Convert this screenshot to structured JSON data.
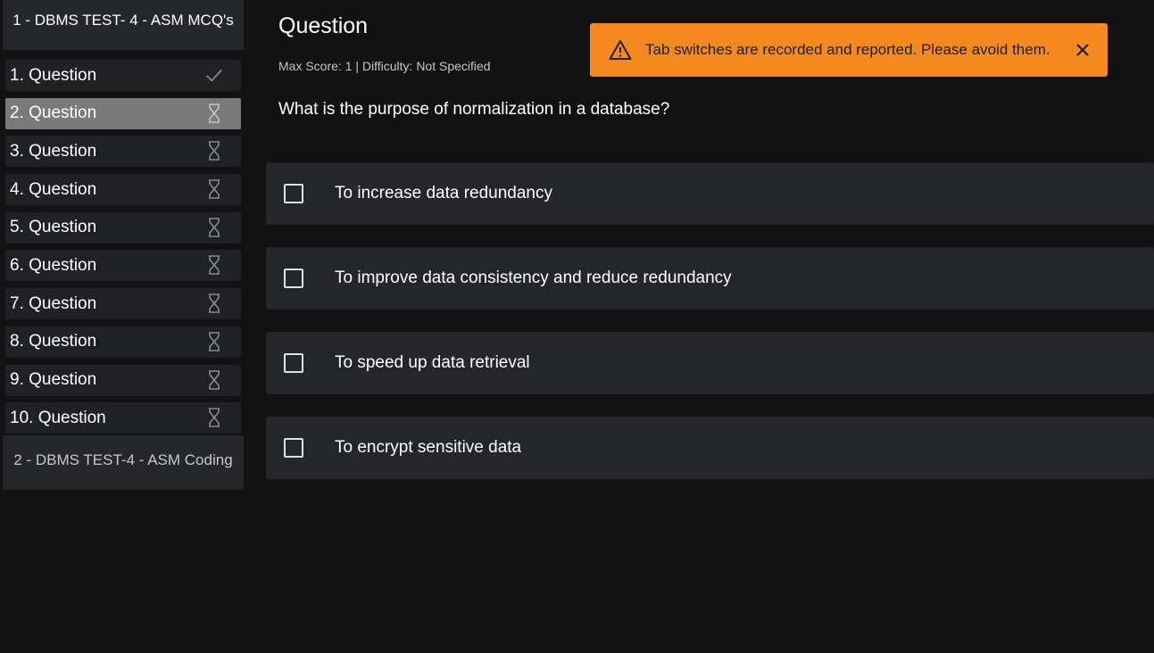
{
  "sidebar": {
    "section1_title": "1 - DBMS TEST- 4 - ASM MCQ's",
    "questions": [
      {
        "label": "1. Question",
        "status": "check-icon"
      },
      {
        "label": "2. Question",
        "status": "hourglass-icon",
        "active": true
      },
      {
        "label": "3. Question",
        "status": "hourglass-icon"
      },
      {
        "label": "4. Question",
        "status": "hourglass-icon"
      },
      {
        "label": "5. Question",
        "status": "hourglass-icon"
      },
      {
        "label": "6. Question",
        "status": "hourglass-icon"
      },
      {
        "label": "7. Question",
        "status": "hourglass-icon"
      },
      {
        "label": "8. Question",
        "status": "hourglass-icon"
      },
      {
        "label": "9. Question",
        "status": "hourglass-icon"
      },
      {
        "label": "10. Question",
        "status": "hourglass-icon"
      }
    ],
    "section2_title": "2 - DBMS TEST-4 - ASM Coding"
  },
  "main": {
    "title": "Question",
    "meta": "Max Score: 1 | Difficulty: Not Specified",
    "question": "What is the purpose of normalization in a database?",
    "options": [
      "To increase data redundancy",
      "To improve data consistency and reduce redundancy",
      "To speed up data retrieval",
      "To encrypt sensitive data"
    ]
  },
  "toast": {
    "message": "Tab switches are recorded and reported. Please avoid them.",
    "icon": "warning-icon",
    "close_icon": "close-icon",
    "color": "#f5891e"
  },
  "colors": {
    "background": "#121212",
    "panel": "#25262a",
    "active_item": "#7a7a7a"
  }
}
